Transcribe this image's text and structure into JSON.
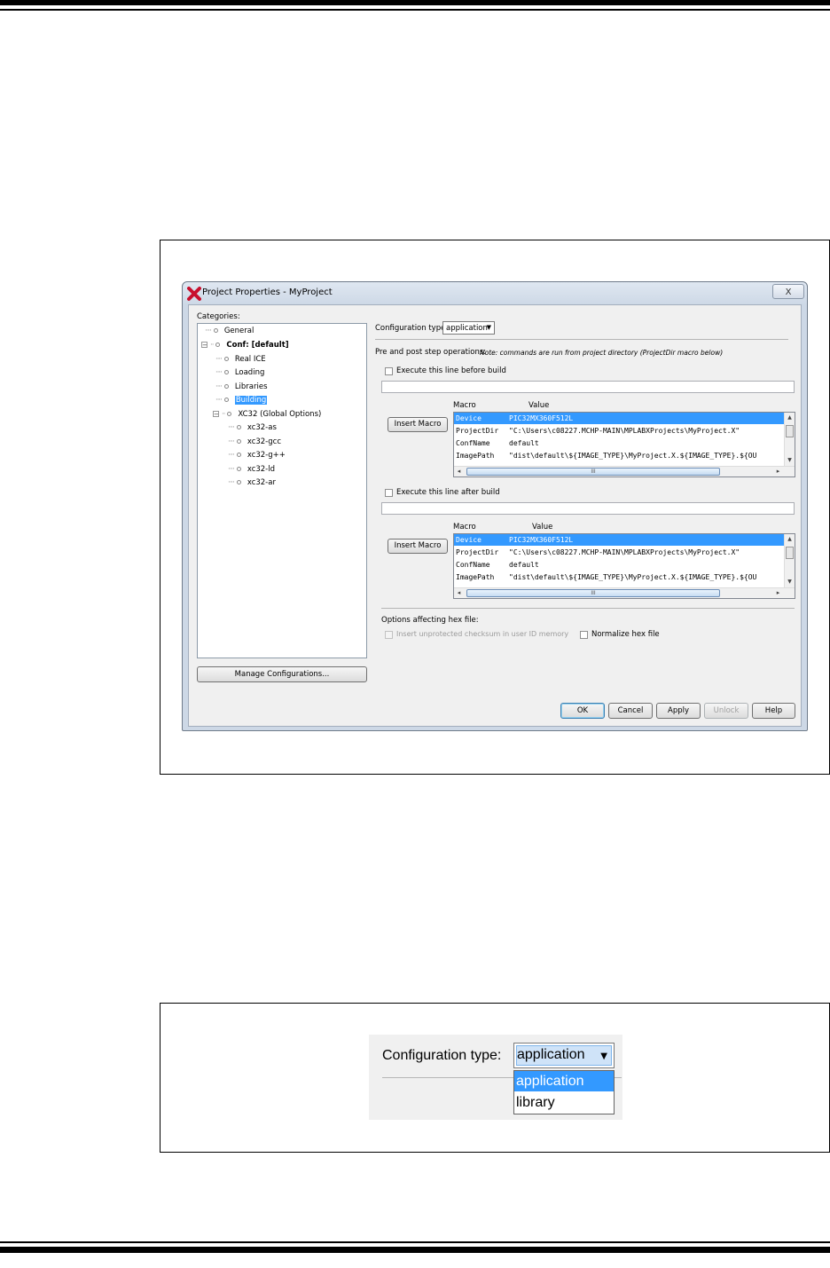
{
  "dialog": {
    "title": "Project Properties - MyProject",
    "close_label": "X",
    "categories_label": "Categories:",
    "tree": [
      {
        "label": "General",
        "bold": false,
        "selected": false
      },
      {
        "label": "Conf: [default]",
        "bold": true,
        "selected": false
      },
      {
        "label": "Real ICE",
        "bold": false,
        "selected": false
      },
      {
        "label": "Loading",
        "bold": false,
        "selected": false
      },
      {
        "label": "Libraries",
        "bold": false,
        "selected": false
      },
      {
        "label": "Building",
        "bold": false,
        "selected": true
      },
      {
        "label": "XC32 (Global Options)",
        "bold": false,
        "selected": false
      },
      {
        "label": "xc32-as",
        "bold": false,
        "selected": false
      },
      {
        "label": "xc32-gcc",
        "bold": false,
        "selected": false
      },
      {
        "label": "xc32-g++",
        "bold": false,
        "selected": false
      },
      {
        "label": "xc32-ld",
        "bold": false,
        "selected": false
      },
      {
        "label": "xc32-ar",
        "bold": false,
        "selected": false
      }
    ],
    "manage_button": "Manage Configurations...",
    "config_type_label": "Configuration type:",
    "config_type_value": "application",
    "pre_post_label": "Pre and post step operations:",
    "pre_post_note": "Note: commands are run from project directory (ProjectDir macro below)",
    "before_build_label": "Execute this line before build",
    "after_build_label": "Execute this line after build",
    "insert_macro_label": "Insert Macro",
    "macro_header": "Macro",
    "value_header": "Value",
    "macros": [
      {
        "name": "Device",
        "value": "PIC32MX360F512L",
        "selected": true
      },
      {
        "name": "ProjectDir",
        "value": "\"C:\\Users\\c08227.MCHP-MAIN\\MPLABXProjects\\MyProject.X\"",
        "selected": false
      },
      {
        "name": "ConfName",
        "value": "default",
        "selected": false
      },
      {
        "name": "ImagePath",
        "value": "\"dist\\default\\${IMAGE_TYPE}\\MyProject.X.${IMAGE_TYPE}.${OU",
        "selected": false
      }
    ],
    "hscroll_grip": "III",
    "hex_options_label": "Options affecting hex file:",
    "checksum_label": "Insert unprotected checksum in user ID memory",
    "normalize_label": "Normalize hex file",
    "buttons": {
      "ok": "OK",
      "cancel": "Cancel",
      "apply": "Apply",
      "unlock": "Unlock",
      "help": "Help"
    }
  },
  "zoom": {
    "label": "Configuration type:",
    "value": "application",
    "options": [
      "application",
      "library"
    ]
  }
}
